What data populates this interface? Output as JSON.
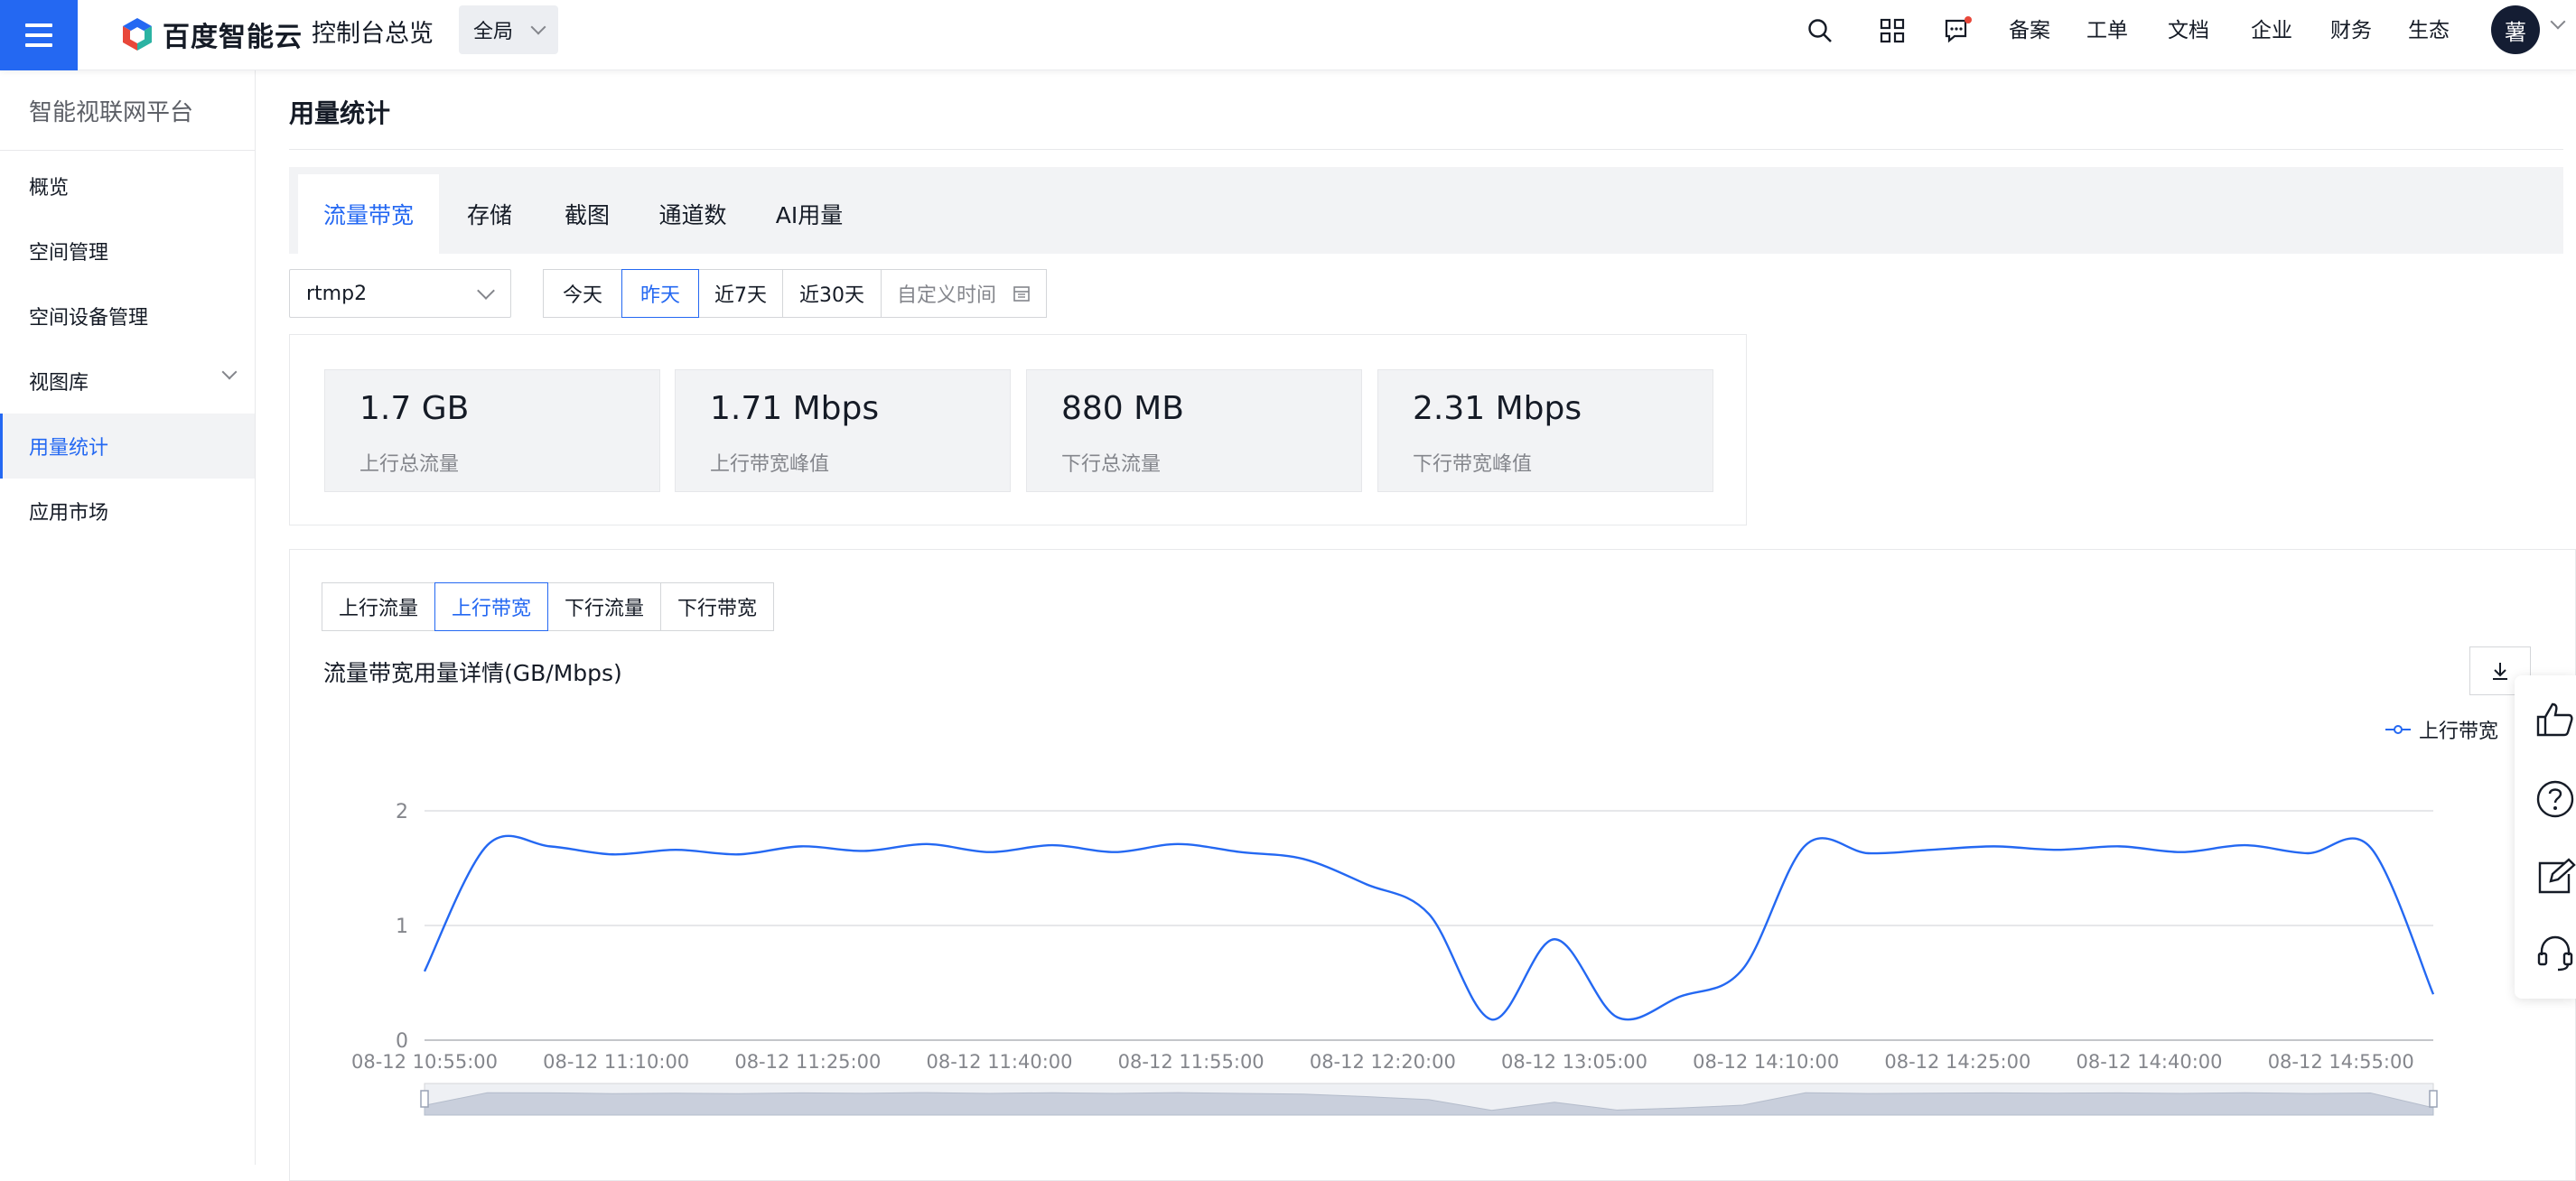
{
  "header": {
    "brand": "百度智能云",
    "title": "控制台总览",
    "region": "全局",
    "nav": [
      "备案",
      "工单",
      "文档",
      "企业",
      "财务",
      "生态"
    ],
    "avatar_initial": "薯",
    "accent_color": "#2468f2",
    "icons": [
      "menu-icon",
      "search-icon",
      "apps-icon",
      "message-icon"
    ]
  },
  "sidebar": {
    "title": "智能视联网平台",
    "items": [
      {
        "label": "概览",
        "active": false
      },
      {
        "label": "空间管理",
        "active": false
      },
      {
        "label": "空间设备管理",
        "active": false
      },
      {
        "label": "视图库",
        "active": false,
        "expandable": true
      },
      {
        "label": "用量统计",
        "active": true
      },
      {
        "label": "应用市场",
        "active": false
      }
    ]
  },
  "page": {
    "title": "用量统计",
    "tabs": [
      {
        "label": "流量带宽",
        "active": true
      },
      {
        "label": "存储",
        "active": false
      },
      {
        "label": "截图",
        "active": false
      },
      {
        "label": "通道数",
        "active": false
      },
      {
        "label": "AI用量",
        "active": false
      }
    ],
    "stream_select": "rtmp2",
    "time_ranges": [
      {
        "label": "今天",
        "active": false
      },
      {
        "label": "昨天",
        "active": true
      },
      {
        "label": "近7天",
        "active": false
      },
      {
        "label": "近30天",
        "active": false
      }
    ],
    "custom_time_placeholder": "自定义时间"
  },
  "stats": [
    {
      "value": "1.7 GB",
      "label": "上行总流量"
    },
    {
      "value": "1.71 Mbps",
      "label": "上行带宽峰值"
    },
    {
      "value": "880 MB",
      "label": "下行总流量"
    },
    {
      "value": "2.31 Mbps",
      "label": "下行带宽峰值"
    }
  ],
  "metrics": [
    {
      "label": "上行流量",
      "active": false
    },
    {
      "label": "上行带宽",
      "active": true
    },
    {
      "label": "下行流量",
      "active": false
    },
    {
      "label": "下行带宽",
      "active": false
    }
  ],
  "chart_title": "流量带宽用量详情(GB/Mbps)",
  "chart_data": {
    "type": "line",
    "title": "",
    "xlabel": "",
    "ylabel": "",
    "ylim": [
      0,
      2
    ],
    "yticks": [
      "0",
      "1",
      "2"
    ],
    "x_tick_labels": [
      "08-12 10:55:00",
      "08-12 11:10:00",
      "08-12 11:25:00",
      "08-12 11:40:00",
      "08-12 11:55:00",
      "08-12 12:20:00",
      "08-12 13:05:00",
      "08-12 14:10:00",
      "08-12 14:25:00",
      "08-12 14:40:00",
      "08-12 14:55:00"
    ],
    "grid": true,
    "legend_position": "top-right",
    "color": "#2468f2",
    "series": [
      {
        "name": "上行带宽",
        "values": [
          0.6,
          1.7,
          1.69,
          1.62,
          1.66,
          1.62,
          1.69,
          1.65,
          1.71,
          1.64,
          1.7,
          1.64,
          1.71,
          1.64,
          1.58,
          1.36,
          1.1,
          0.18,
          0.88,
          0.2,
          0.38,
          0.62,
          1.7,
          1.63,
          1.66,
          1.69,
          1.66,
          1.69,
          1.64,
          1.7,
          1.63,
          1.68,
          0.4
        ]
      }
    ]
  }
}
